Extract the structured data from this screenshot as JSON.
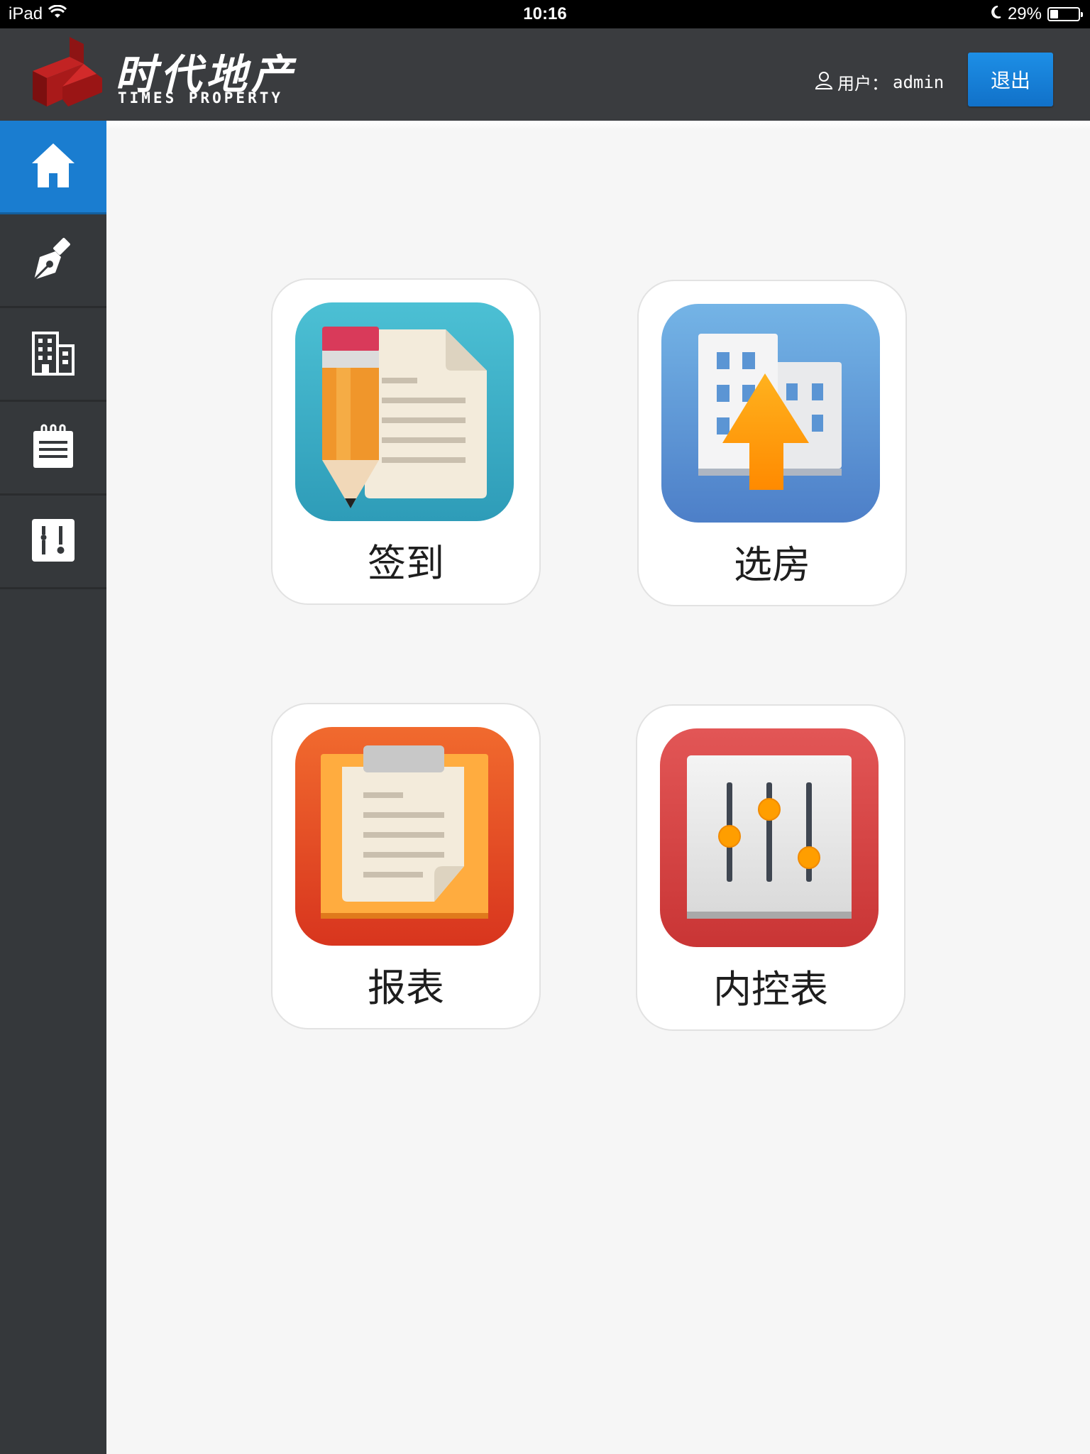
{
  "status_bar": {
    "device": "iPad",
    "time": "10:16",
    "battery_percent": "29%",
    "battery_level": 0.29
  },
  "header": {
    "logo_cn": "时代地产",
    "logo_en": "TIMES  PROPERTY",
    "user_label": "用户：",
    "username": "admin",
    "logout_label": "退出"
  },
  "sidebar": {
    "items": [
      {
        "icon": "home-icon",
        "active": true
      },
      {
        "icon": "pen-icon",
        "active": false
      },
      {
        "icon": "building-icon",
        "active": false
      },
      {
        "icon": "notepad-icon",
        "active": false
      },
      {
        "icon": "info-icon",
        "active": false
      }
    ]
  },
  "tiles": [
    {
      "label": "签到",
      "icon": "sign-in-document-pencil-icon",
      "color": "#3aa9c4"
    },
    {
      "label": "选房",
      "icon": "select-house-building-arrow-icon",
      "color": "#5b8fd4"
    },
    {
      "label": "报表",
      "icon": "report-clipboard-icon",
      "color": "#e8501e"
    },
    {
      "label": "内控表",
      "icon": "control-sliders-icon",
      "color": "#d43f3f"
    }
  ]
}
